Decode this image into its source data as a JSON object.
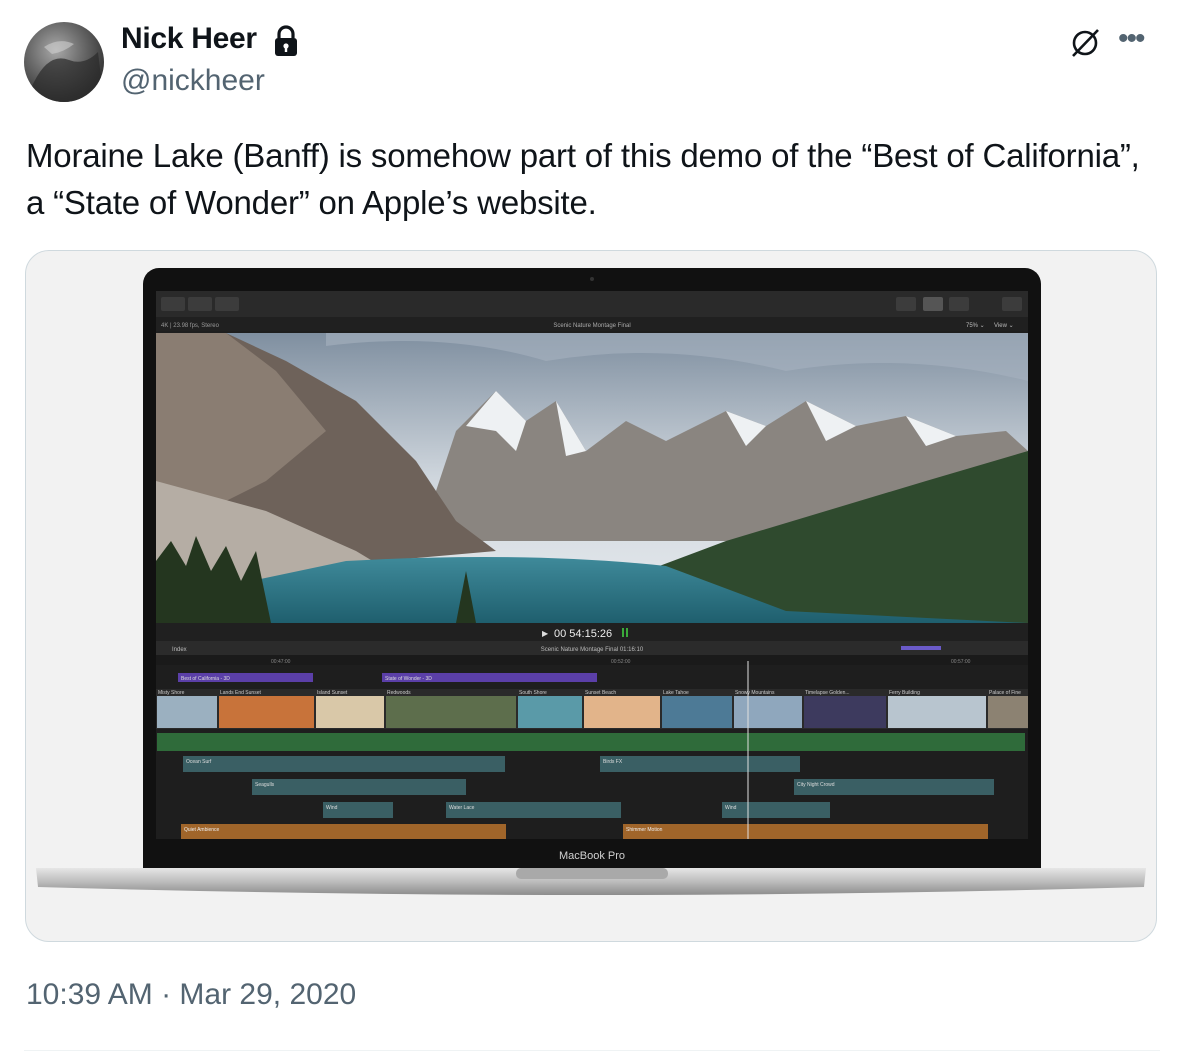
{
  "author": {
    "name": "Nick Heer",
    "handle": "@nickheer"
  },
  "tweet": {
    "text": "Moraine Lake (Banff) is somehow part of this demo of the “Best of California”, a “State of Wonder” on Apple’s website."
  },
  "timestamp": "10:39 AM · Mar 29, 2020",
  "icons": [
    "lock-icon",
    "grok-icon",
    "more-icon"
  ],
  "laptop": {
    "brand_label": "MacBook Pro",
    "app": {
      "meta_left": "4K | 23.98 fps, Stereo",
      "project_title": "Scenic Nature Montage Final",
      "zoom": "75% ⌄",
      "view": "View ⌄",
      "timecode": "00 54:15:26",
      "index_label": "Index",
      "timeline_title": "Scenic Nature Montage Final  01:16:10",
      "ruler_marks": [
        "00:47:00",
        "00:52:00",
        "00:57:00"
      ],
      "compound_clips": [
        "Best of California - 3D",
        "State of Wonder - 3D"
      ],
      "clips": [
        "Misty Shore",
        "Lands End Sunset",
        "Island Sunset",
        "Redwoods",
        "South Shore",
        "Sunset Beach",
        "Lake Tahoe",
        "Snowy Mountains",
        "Timelapse Golden...",
        "Ferry Building",
        "Palace of Fine"
      ],
      "audio_clips": [
        "Ocean Surf",
        "Birds FX",
        "Seagulls",
        "City Night Crowd",
        "Wind",
        "Water Lace",
        "Wind",
        "Quiet Ambience",
        "Shimmer Motion"
      ]
    }
  }
}
